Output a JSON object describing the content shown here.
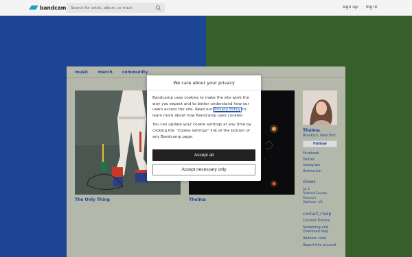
{
  "header": {
    "logo_text": "bandcamp",
    "search_placeholder": "Search for artist, album, or track",
    "signup_label": "sign up",
    "login_label": "log in"
  },
  "nav": {
    "items": [
      {
        "label": "music"
      },
      {
        "label": "merch"
      },
      {
        "label": "community"
      }
    ]
  },
  "albums": [
    {
      "title": "The Only Thing"
    },
    {
      "title": "Thelma"
    }
  ],
  "artist": {
    "name": "Thelma",
    "location": "Brooklyn, New York",
    "follow_label": "Follow",
    "links": [
      "Facebook",
      "Twitter",
      "Instagram",
      "thelma.fun"
    ],
    "shows_heading": "shows",
    "show_date": "Jul 3",
    "show_venue_line1": "Rutland County",
    "show_venue_line2": "Museum",
    "show_place": "Oakham, UK",
    "contact_heading": "contact / help",
    "help_links": [
      "Contact Thelma",
      "Streaming and",
      "Download help",
      "Redeem code",
      "Report this account"
    ]
  },
  "cookie_modal": {
    "title": "We care about your privacy",
    "para1_before": "Bandcamp uses cookies to make the site work the way you expect and to better understand how our users access the site. Read our ",
    "privacy_link": "Privacy Policy",
    "para1_after": " to learn more about how Bandcamp uses cookies.",
    "para2": "You can update your cookie settings at any time by clicking the “Cookie settings” link at the bottom of any Bandcamp page.",
    "accept_all_label": "Accept all",
    "accept_necessary_label": "Accept necessary only"
  },
  "colors": {
    "background_blue": "#1d4595",
    "background_green": "#365f2c",
    "link_blue": "#1d4595",
    "panel": "#b4b8aa",
    "logo_accent": "#1da0c3"
  },
  "icons": {
    "search": "search-icon",
    "logo": "bandcamp-logo-icon"
  }
}
